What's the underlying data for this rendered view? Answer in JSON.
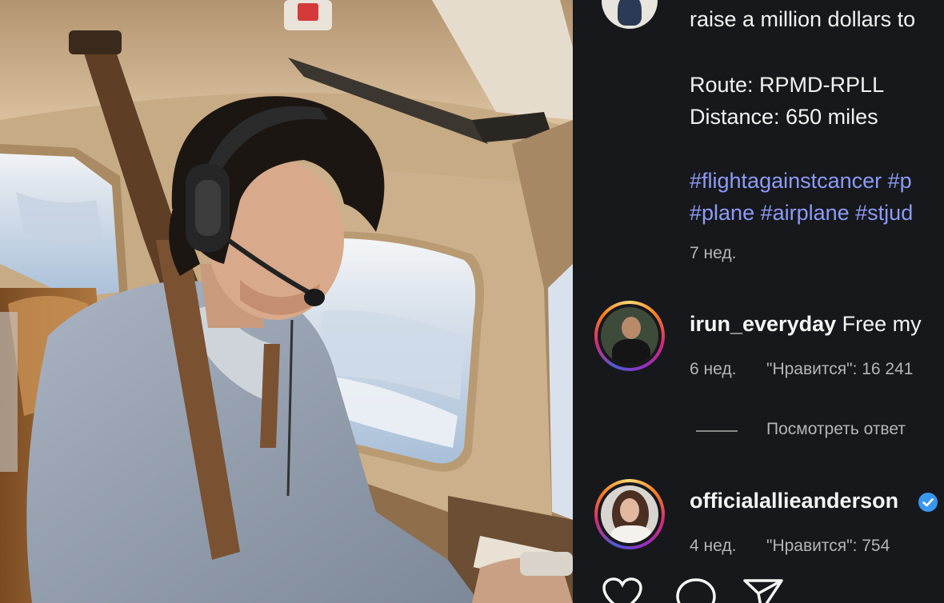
{
  "post": {
    "caption_line_top": "raise a million dollars to",
    "route": "Route: RPMD-RPLL",
    "distance": "Distance: 650 miles",
    "hashtags_line1": "#flightagainstcancer #p",
    "hashtags_line2": "#plane #airplane #stjud",
    "time_ago": "7 нед."
  },
  "comments": [
    {
      "username": "irun_everyday",
      "text": " Free my",
      "time_ago": "6 нед.",
      "likes": "\"Нравится\": 16 241",
      "view_replies": "Посмотреть ответ"
    },
    {
      "username": "officialallieanderson",
      "verified": true,
      "time_ago": "4 нед.",
      "likes": "\"Нравится\": 754"
    }
  ],
  "actions": {
    "like_icon": "heart-icon",
    "comment_icon": "comment-icon",
    "share_icon": "send-icon"
  },
  "colors": {
    "panel_bg": "#17181c",
    "hashtag": "#8d9bf5",
    "verified": "#3897f0"
  }
}
